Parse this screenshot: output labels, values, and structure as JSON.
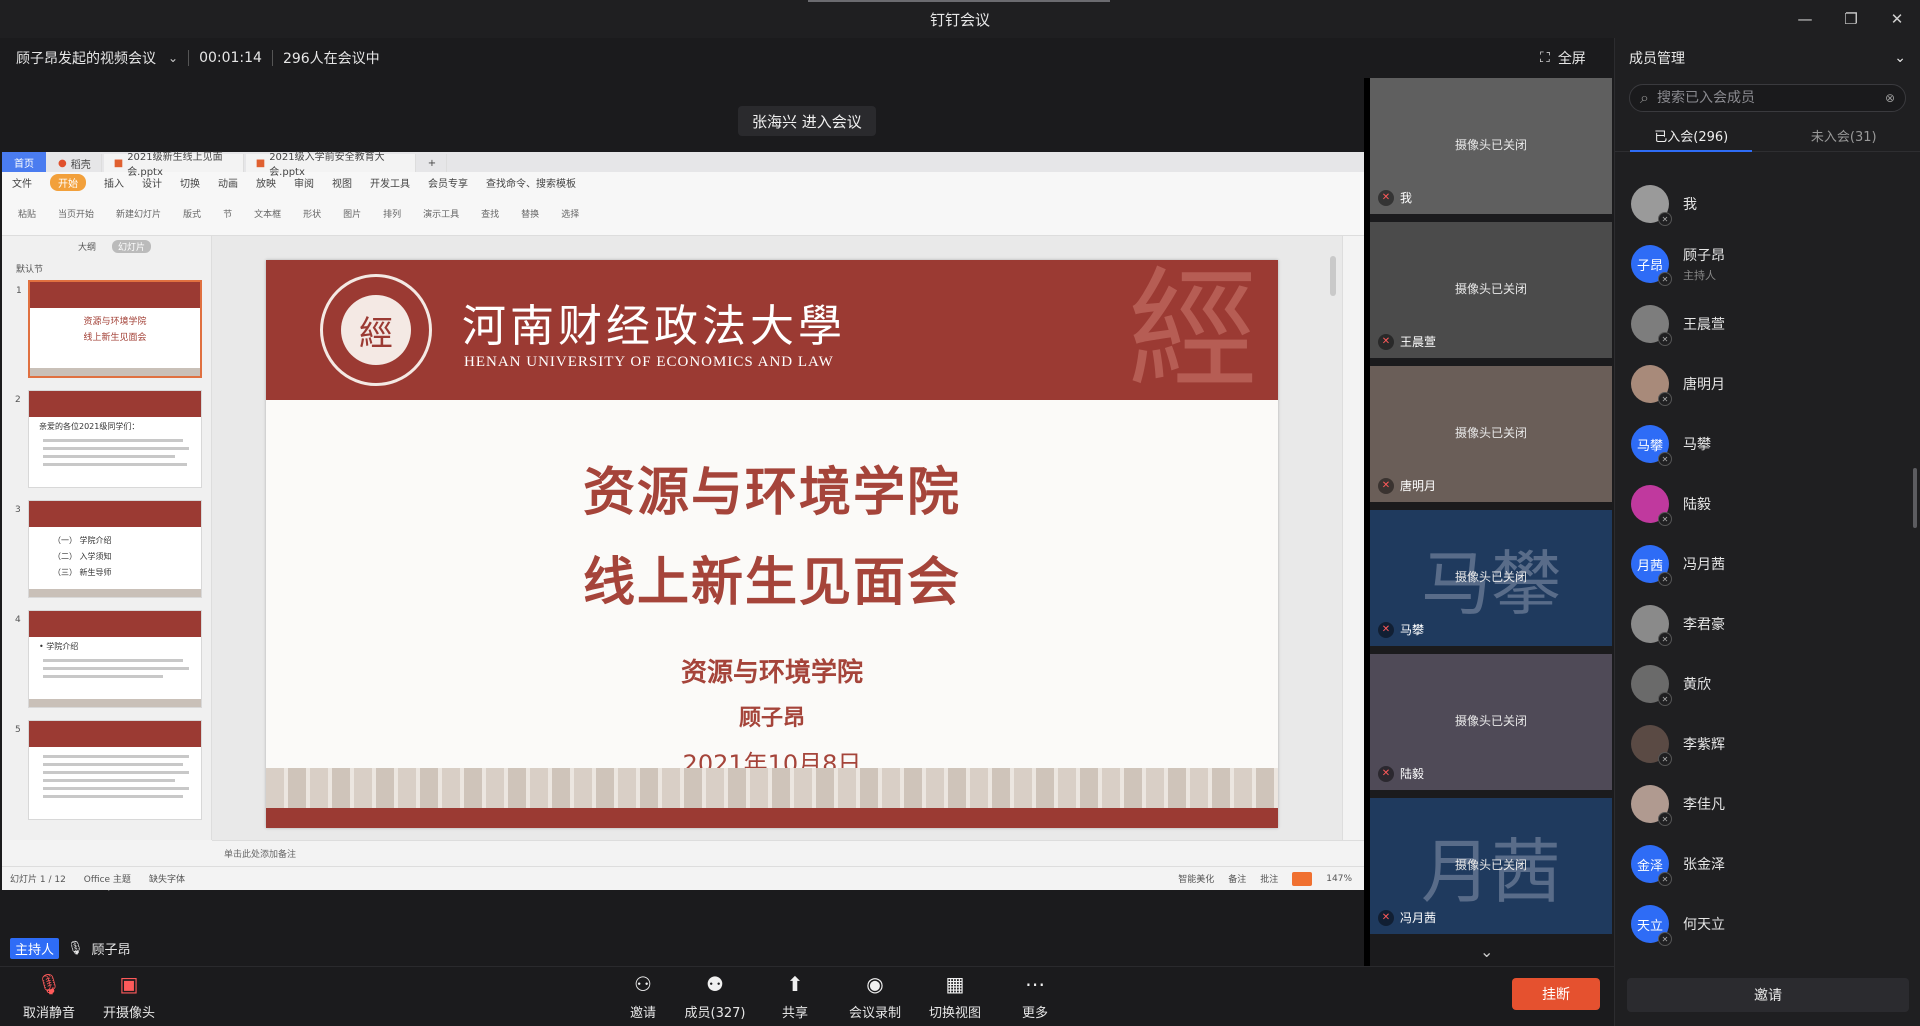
{
  "window": {
    "title": "钉钉会议",
    "min": "—",
    "max": "❐",
    "close": "✕"
  },
  "meeting": {
    "title": "顾子昂发起的视频会议",
    "duration": "00:01:14",
    "count": "296人在会议中",
    "fullscreen": "全屏"
  },
  "toast": "张海兴 进入会议",
  "wps": {
    "tabs": [
      "首页",
      "稻壳",
      "2021级新生线上见面会.pptx",
      "2021级入学前安全教育大会.pptx"
    ],
    "menu": [
      "文件",
      "开始",
      "插入",
      "设计",
      "切换",
      "动画",
      "放映",
      "审阅",
      "视图",
      "开发工具",
      "会员专享",
      "查找命令、搜索模板"
    ],
    "ribbon": [
      "粘贴",
      "当页开始",
      "新建幻灯片",
      "版式",
      "节",
      "文本框",
      "形状",
      "图片",
      "排列",
      "演示工具",
      "查找",
      "替换",
      "选择"
    ],
    "panel": {
      "outline": "大纲",
      "slides": "幻灯片",
      "section": "默认节"
    },
    "thumb_title_1": "资源与环境学院",
    "thumb_title_2": "线上新生见面会",
    "thumb2_text": "亲爱的各位2021级同学们：",
    "thumb3_items": [
      "（一） 学院介绍",
      "（二） 入学须知",
      "（三） 新生导师"
    ],
    "thumb4_text": "• 学院介绍",
    "notes": "单击此处添加备注",
    "status": {
      "slide": "幻灯片 1 / 12",
      "theme": "Office 主题",
      "font": "缺失字体",
      "beautify": "智能美化",
      "comment": "备注",
      "annot": "批注",
      "zoom": "147%"
    }
  },
  "slide": {
    "uni_cn": "河南财经政法大學",
    "uni_en": "HENAN UNIVERSITY OF ECONOMICS AND LAW",
    "seal": "經",
    "title1": "资源与环境学院",
    "title2": "线上新生见面会",
    "org": "资源与环境学院",
    "presenter": "顾子昂",
    "date": "2021年10月8日"
  },
  "host": {
    "badge": "主持人",
    "name": "顾子昂"
  },
  "gallery": [
    {
      "name": "我",
      "status": "摄像头已关闭",
      "bg": "#5f5f5f"
    },
    {
      "name": "王晨萱",
      "status": "摄像头已关闭",
      "bg": "#4b4b4b"
    },
    {
      "name": "唐明月",
      "status": "摄像头已关闭",
      "bg": "#6a5e58"
    },
    {
      "name": "马攀",
      "status": "摄像头已关闭",
      "bg": "#1f3a5e",
      "big": "马攀"
    },
    {
      "name": "陆毅",
      "status": "摄像头已关闭",
      "bg": "#4f4a57"
    },
    {
      "name": "冯月茜",
      "status": "摄像头已关闭",
      "bg": "#1f3a5e",
      "big": "月茜"
    }
  ],
  "panel": {
    "title": "成员管理",
    "search_placeholder": "搜索已入会成员",
    "tab_joined": "已入会(296)",
    "tab_notjoined": "未入会(31)",
    "invite": "邀请",
    "members": [
      {
        "name": "我",
        "avatar": "",
        "color": "#9a9a9a"
      },
      {
        "name": "顾子昂",
        "avatar": "子昂",
        "color": "#2e6cf6",
        "role": "主持人"
      },
      {
        "name": "王晨萱",
        "avatar": "",
        "color": "#7d7d7d"
      },
      {
        "name": "唐明月",
        "avatar": "",
        "color": "#a88a7a"
      },
      {
        "name": "马攀",
        "avatar": "马攀",
        "color": "#2e6cf6"
      },
      {
        "name": "陆毅",
        "avatar": "",
        "color": "#c0399e"
      },
      {
        "name": "冯月茜",
        "avatar": "月茜",
        "color": "#2e6cf6"
      },
      {
        "name": "李君豪",
        "avatar": "",
        "color": "#8a8a8a"
      },
      {
        "name": "黄欣",
        "avatar": "",
        "color": "#6a6a6a"
      },
      {
        "name": "李紫辉",
        "avatar": "",
        "color": "#5a4a44"
      },
      {
        "name": "李佳凡",
        "avatar": "",
        "color": "#b09a90"
      },
      {
        "name": "张金泽",
        "avatar": "金泽",
        "color": "#2e6cf6"
      },
      {
        "name": "何天立",
        "avatar": "天立",
        "color": "#2e6cf6"
      }
    ]
  },
  "toolbar": {
    "unmute": "取消静音",
    "camera": "开摄像头",
    "invite": "邀请",
    "members": "成员(327)",
    "share": "共享",
    "record": "会议录制",
    "view": "切换视图",
    "more": "更多",
    "hangup": "挂断"
  }
}
